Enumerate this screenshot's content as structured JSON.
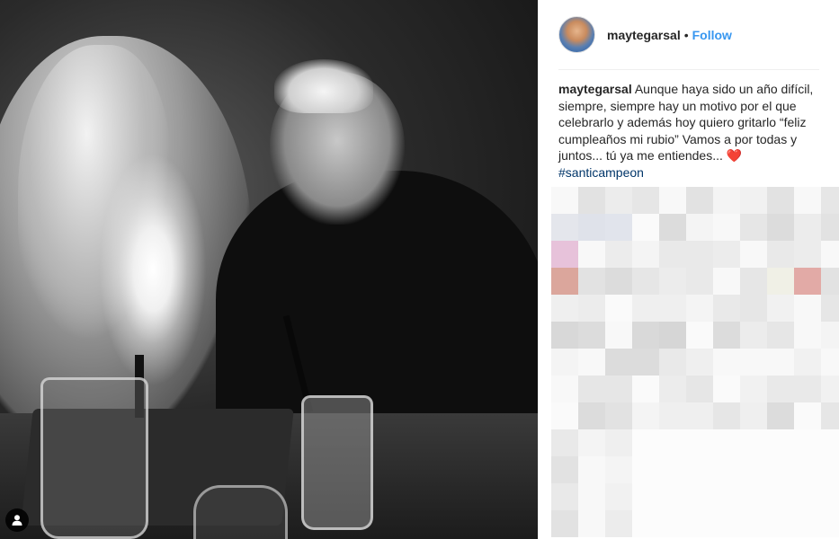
{
  "post": {
    "username": "maytegarsal",
    "separator": "•",
    "follow_label": "Follow",
    "caption_user": "maytegarsal",
    "caption_text": "Aunque haya sido un año difícil, siempre, siempre hay un motivo por el que celebrarlo y además hoy quiero gritarlo “feliz cumpleaños mi rubio” Vamos a por todas y juntos... tú ya me entiendes...",
    "caption_emoji": "❤️",
    "hashtag": "#santicampeon"
  },
  "icons": {
    "user_tag": "user-tag-icon",
    "heart": "heart-emoji-icon"
  },
  "colors": {
    "follow": "#3897f0",
    "hashtag": "#003569",
    "text": "#262626",
    "divider": "#efefef"
  }
}
